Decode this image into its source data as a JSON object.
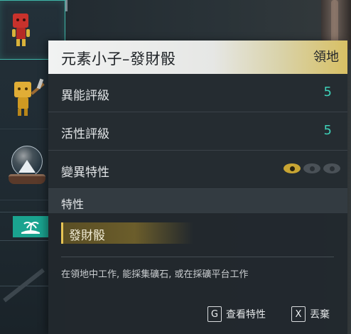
{
  "tooltip": {
    "title": "元素小子–發財骰",
    "tag": "領地",
    "stats": [
      {
        "label": "異能評級",
        "value": "5"
      },
      {
        "label": "活性評級",
        "value": "5"
      }
    ],
    "mutation": {
      "label": "變異特性",
      "level": 1,
      "max": 3
    },
    "traits_header": "特性",
    "trait": "發財骰",
    "description": "在領地中工作, 能採集礦石, 或在採礦平台工作",
    "actions": [
      {
        "key": "G",
        "label": "查看特性"
      },
      {
        "key": "X",
        "label": "丟棄"
      }
    ]
  },
  "colors": {
    "accent_teal": "#3ed1b8",
    "accent_gold": "#e6c454",
    "slot_highlight": "#3fb7a9"
  },
  "icons": {
    "slot1": "red-block-pal-icon",
    "slot2": "gold-block-pal-miner-icon",
    "slot3": "snow-globe-icon",
    "slot4": "island-icon",
    "mutation": "eye-icon"
  }
}
